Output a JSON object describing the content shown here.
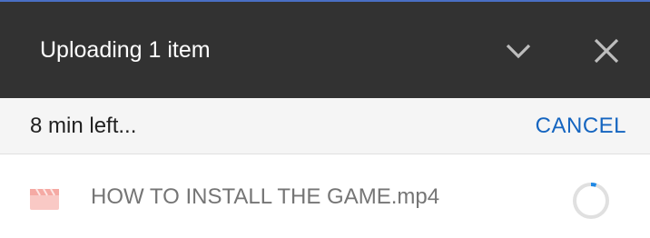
{
  "header": {
    "title": "Uploading 1 item",
    "collapse_icon": "chevron-down-icon",
    "close_icon": "close-icon"
  },
  "status": {
    "time_left": "8 min left...",
    "cancel_label": "CANCEL"
  },
  "files": [
    {
      "name": "HOW TO INSTALL THE GAME.mp4",
      "type_icon": "video-file-icon",
      "progress": 0.05
    }
  ],
  "colors": {
    "header_bg": "#323232",
    "accent": "#1565c0",
    "video_icon": "#f7b8b4"
  }
}
